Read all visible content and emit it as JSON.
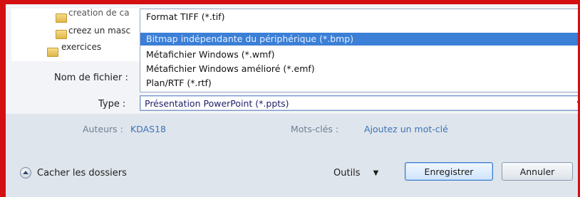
{
  "file_list": {
    "items": [
      {
        "label": "creation de ca",
        "icon": "folder-icon"
      },
      {
        "label": "creez un masc",
        "icon": "folder-icon"
      },
      {
        "label": "exercices",
        "icon": "folder-icon"
      }
    ]
  },
  "form": {
    "filename_label": "Nom de fichier :",
    "type_label": "Type :",
    "type_value": "Présentation PowerPoint (*.ppts)",
    "type_arrow": "▾"
  },
  "dropdown": {
    "options": [
      {
        "label": "Format TIFF (*.tif)",
        "selected": false
      },
      {
        "label": "Bitmap indépendante du périphérique (*.bmp)",
        "selected": true
      },
      {
        "label": "Métafichier Windows (*.wmf)",
        "selected": false
      },
      {
        "label": "Métafichier Windows amélioré (*.emf)",
        "selected": false
      },
      {
        "label": "Plan/RTF (*.rtf)",
        "selected": false
      }
    ]
  },
  "metadata": {
    "authors_label": "Auteurs :",
    "authors_value": "KDAS18",
    "keywords_label": "Mots-clés :",
    "keywords_value": "Ajoutez un mot-clé"
  },
  "footer": {
    "hide_folders_label": "Cacher les dossiers",
    "tools_label": "Outils",
    "tools_caret": "▼",
    "save_label": "Enregistrer",
    "cancel_label": "Annuler"
  },
  "colors": {
    "frame_border": "#d40f12",
    "selection": "#3b7fd6",
    "link": "#3d73b6"
  }
}
